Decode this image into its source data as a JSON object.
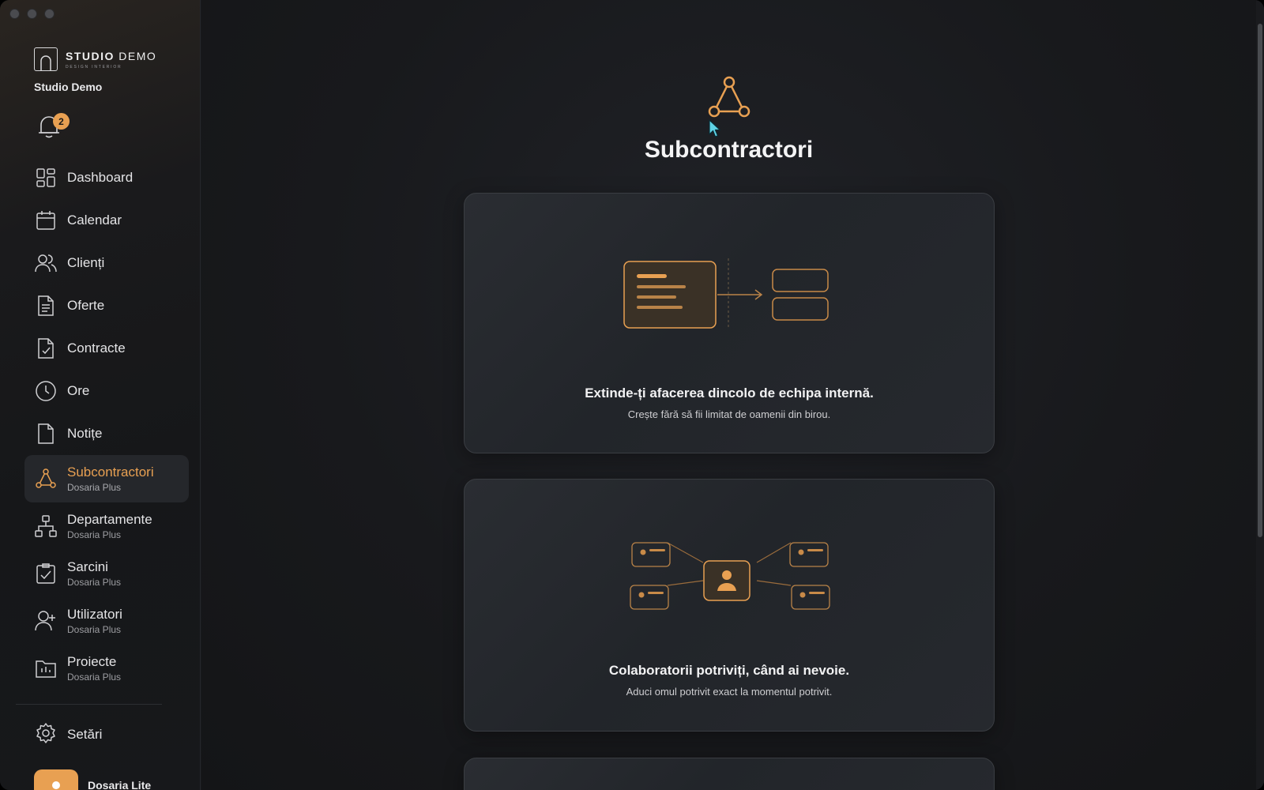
{
  "brand": {
    "name_bold": "STUDIO",
    "name_light": "DEMO",
    "tagline": "DESIGN INTERIOR"
  },
  "workspace": "Studio Demo",
  "notifications": {
    "count": "2"
  },
  "nav": [
    {
      "label": "Dashboard",
      "icon": "dashboard-icon"
    },
    {
      "label": "Calendar",
      "icon": "calendar-icon"
    },
    {
      "label": "Clienți",
      "icon": "users-icon"
    },
    {
      "label": "Oferte",
      "icon": "document-icon"
    },
    {
      "label": "Contracte",
      "icon": "contract-icon"
    },
    {
      "label": "Ore",
      "icon": "clock-icon"
    },
    {
      "label": "Notițe",
      "icon": "note-icon"
    },
    {
      "label": "Subcontractori",
      "sub": "Dosaria Plus",
      "icon": "network-icon",
      "active": true
    },
    {
      "label": "Departamente",
      "sub": "Dosaria Plus",
      "icon": "org-chart-icon"
    },
    {
      "label": "Sarcini",
      "sub": "Dosaria Plus",
      "icon": "task-icon"
    },
    {
      "label": "Utilizatori",
      "sub": "Dosaria Plus",
      "icon": "add-user-icon"
    },
    {
      "label": "Proiecte",
      "sub": "Dosaria Plus",
      "icon": "folder-icon"
    }
  ],
  "settings": {
    "label": "Setări"
  },
  "account": {
    "name": "Dosaria Lite"
  },
  "main": {
    "title": "Subcontractori",
    "cards": [
      {
        "title": "Extinde-ți afacerea dincolo de echipa internă.",
        "subtitle": "Crește fără să fii limitat de oamenii din birou."
      },
      {
        "title": "Colaboratorii potriviți, când ai nevoie.",
        "subtitle": "Aduci omul potrivit exact la momentul potrivit."
      }
    ]
  },
  "colors": {
    "accent": "#e8a052",
    "background": "#17191c",
    "sidebar": "#161719",
    "card": "#25282d"
  }
}
